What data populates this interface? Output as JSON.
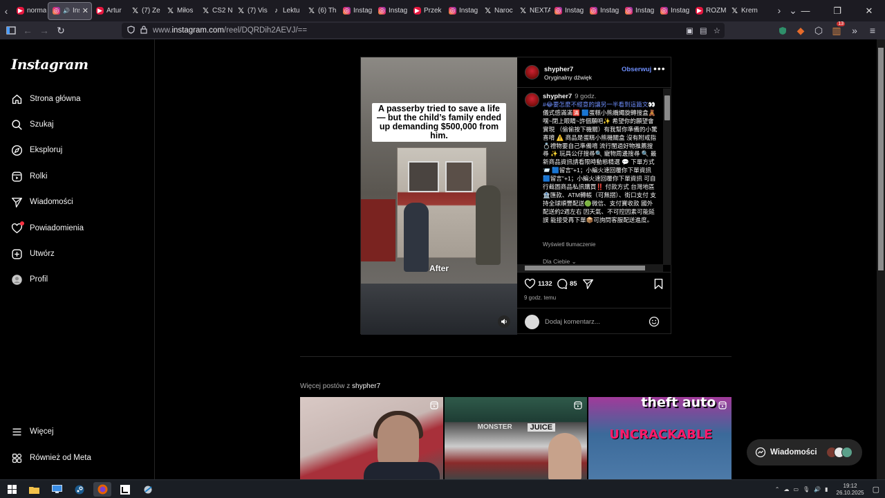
{
  "browser": {
    "tabs": [
      {
        "favicon": "youtube-icon",
        "label": "norma",
        "active": false
      },
      {
        "favicon": "instagram-icon",
        "label": "Insta",
        "active": true,
        "audio": true
      },
      {
        "favicon": "youtube-icon",
        "label": "Artur",
        "active": false
      },
      {
        "favicon": "x-icon",
        "label": "(7) Ze",
        "active": false
      },
      {
        "favicon": "x-icon",
        "label": "Miłos",
        "active": false
      },
      {
        "favicon": "x-icon",
        "label": "CS2 N",
        "active": false
      },
      {
        "favicon": "x-icon",
        "label": "(7) Vis",
        "active": false
      },
      {
        "favicon": "tiktok-icon",
        "label": "Lektu",
        "active": false
      },
      {
        "favicon": "x-icon",
        "label": "(6) Th",
        "active": false
      },
      {
        "favicon": "instagram-icon",
        "label": "Instag",
        "active": false
      },
      {
        "favicon": "instagram-icon",
        "label": "Instag",
        "active": false
      },
      {
        "favicon": "youtube-icon",
        "label": "Przek",
        "active": false
      },
      {
        "favicon": "instagram-icon",
        "label": "Instag",
        "active": false
      },
      {
        "favicon": "x-icon",
        "label": "Naroc",
        "active": false
      },
      {
        "favicon": "x-icon",
        "label": "NEXTA",
        "active": false
      },
      {
        "favicon": "instagram-icon",
        "label": "Instag",
        "active": false
      },
      {
        "favicon": "instagram-icon",
        "label": "Instag",
        "active": false
      },
      {
        "favicon": "instagram-icon",
        "label": "Instag",
        "active": false
      },
      {
        "favicon": "instagram-icon",
        "label": "Instag",
        "active": false
      },
      {
        "favicon": "youtube-icon",
        "label": "ROZM",
        "active": false
      },
      {
        "favicon": "x-icon",
        "label": "Krem",
        "active": false
      }
    ],
    "url_prefix": "www.",
    "url_host": "instagram.com",
    "url_path": "/reel/DQRDih2AEVJ/==",
    "extension_badge": "13"
  },
  "instagram": {
    "logo": "Instagram",
    "nav": [
      {
        "icon": "home-icon",
        "label": "Strona główna"
      },
      {
        "icon": "search-icon",
        "label": "Szukaj"
      },
      {
        "icon": "explore-icon",
        "label": "Eksploruj"
      },
      {
        "icon": "reels-icon",
        "label": "Rolki"
      },
      {
        "icon": "messages-icon",
        "label": "Wiadomości"
      },
      {
        "icon": "heart-icon",
        "label": "Powiadomienia"
      },
      {
        "icon": "create-icon",
        "label": "Utwórz"
      },
      {
        "icon": "profile-icon",
        "label": "Profil"
      }
    ],
    "nav_bottom": [
      {
        "icon": "menu-icon",
        "label": "Więcej"
      },
      {
        "icon": "meta-icon",
        "label": "Również od Meta"
      }
    ]
  },
  "post": {
    "video_caption": "A passerby tried to save a life — but the child’s family ended up demanding $500,000 from him.",
    "video_overlay": "After",
    "username": "shypher7",
    "audio": "Oryginalny dźwięk",
    "follow": "Obserwuj",
    "comment": {
      "username": "shypher7",
      "time": "9 godz.",
      "text_highlight": "#😂要怎麼不經意的讓另一半看到這篇文",
      "text": "👀 儀式感滿滿🈵 🟦蛋糕小熊纜繩旋轉搜盒🧸 嘿~閉上眼睛~許個願吧✨ 希望你的願望會實現 （偷偷按下機關）有我幫你準備的小驚喜唷 ⚠️ 商品是蛋糕小熊機關盒 沒有附戒指💍禮物要自己準備唷 流行閨過好物推薦搜尋 ✨ 玩具公仔搜尋🔍 寵物周邊搜尋 🔍 最新商品資訊請看限時動態精選 💬 下單方式📨 🟦留言\"+1；小編火速回覆你下單資訊 🟦留言\"+1；小編火速回覆你下單資訊 可自行截圖商品私訊購買‼️ 付款方式 台灣地區🏦匯款、ATM轉帳（可無摺）、街口支付 支持全球順豐配送🟢微信、支付寶收款 國外配送約2週左右 因天氣、不可控因素可能延誤 能接受再下單📦可詢問客服配送進度。",
      "translate": "Wyświetl tłumaczenie",
      "for_you": "Dla Ciebie"
    },
    "likes": "1132",
    "comments": "85",
    "time_ago": "9 godz. temu",
    "add_comment_placeholder": "Dodaj komentarz..."
  },
  "more_posts": {
    "prefix": "Więcej postów z ",
    "user": "shypher7",
    "thumbs": [
      {
        "kind": "reel",
        "text": ""
      },
      {
        "kind": "reel",
        "text_a": "MONSTER",
        "text_b": "JUICE"
      },
      {
        "kind": "reel",
        "text_a": "theft auto",
        "text_b": "UNCRACKABLE"
      }
    ]
  },
  "messages_pill": {
    "label": "Wiadomości"
  },
  "taskbar": {
    "time": "19:12",
    "date": "26.10.2025"
  }
}
